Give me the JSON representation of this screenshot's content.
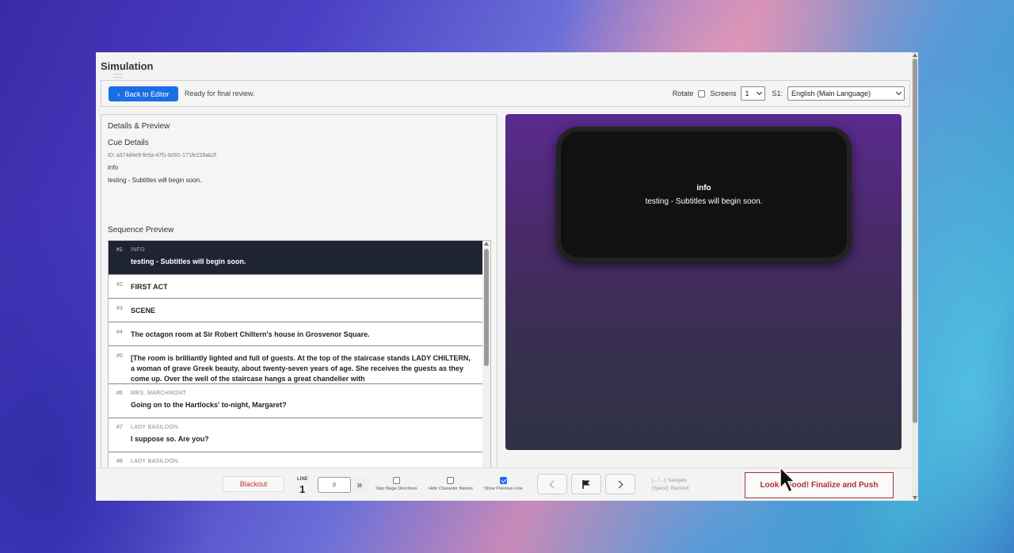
{
  "window": {
    "title": "Simulation"
  },
  "toolbar": {
    "back_label": "Back to Editor",
    "status": "Ready for final review.",
    "rotate_label": "Rotate",
    "screens_label": "Screens",
    "screens_value": "1",
    "s1_label": "S1:",
    "language_value": "English (Main Language)"
  },
  "details": {
    "heading": "Details & Preview",
    "cue_heading": "Cue Details",
    "cue_id": "ID: a374d4e9-fe5a-47f1-b091-171fe228ab2f",
    "cue_character": "info",
    "cue_text": "testing - Subtitles will begin soon."
  },
  "sequence": {
    "heading": "Sequence Preview",
    "items": [
      {
        "num": "#1",
        "char": "INFO",
        "text": "testing - Subtitles will begin soon."
      },
      {
        "num": "#2",
        "char": "",
        "text": "FIRST ACT"
      },
      {
        "num": "#3",
        "char": "",
        "text": "SCENE"
      },
      {
        "num": "#4",
        "char": "",
        "text": "The octagon room at Sir Robert Chiltern's house in Grosvenor Square."
      },
      {
        "num": "#5",
        "char": "",
        "text": "[The room is brilliantly lighted and full of guests. At the top of the staircase stands LADY CHILTERN, a woman of grave Greek beauty, about twenty-seven years of age. She receives the guests as they come up. Over the well of the staircase hangs a great chandelier with"
      },
      {
        "num": "#6",
        "char": "MRS. MARCHMONT.",
        "text": "Going on to the Hartlocks' to-night, Margaret?"
      },
      {
        "num": "#7",
        "char": "LADY BASILDON.",
        "text": "I suppose so. Are you?"
      },
      {
        "num": "#8",
        "char": "LADY BASILDON.",
        "text": ""
      }
    ]
  },
  "preview": {
    "character": "info",
    "text": "testing - Subtitles will begin soon."
  },
  "controls": {
    "blackout_label": "Blackout",
    "line_label": "LINE",
    "line_value": "1",
    "line_placeholder": "#",
    "go_symbol": "»",
    "skip_stage_label": "Skip Stage Directions",
    "hide_names_label": "Hide Character Names",
    "show_prev_label": "Show Previous Line",
    "hint_navigate": "[←/→]: Navigate",
    "hint_blackout": "[Space]: Blackout",
    "finalize_label": "Looks Good! Finalize and Push"
  },
  "colors": {
    "accent": "#1a6ee6",
    "danger": "#b03030",
    "active_row": "#1f2432"
  }
}
